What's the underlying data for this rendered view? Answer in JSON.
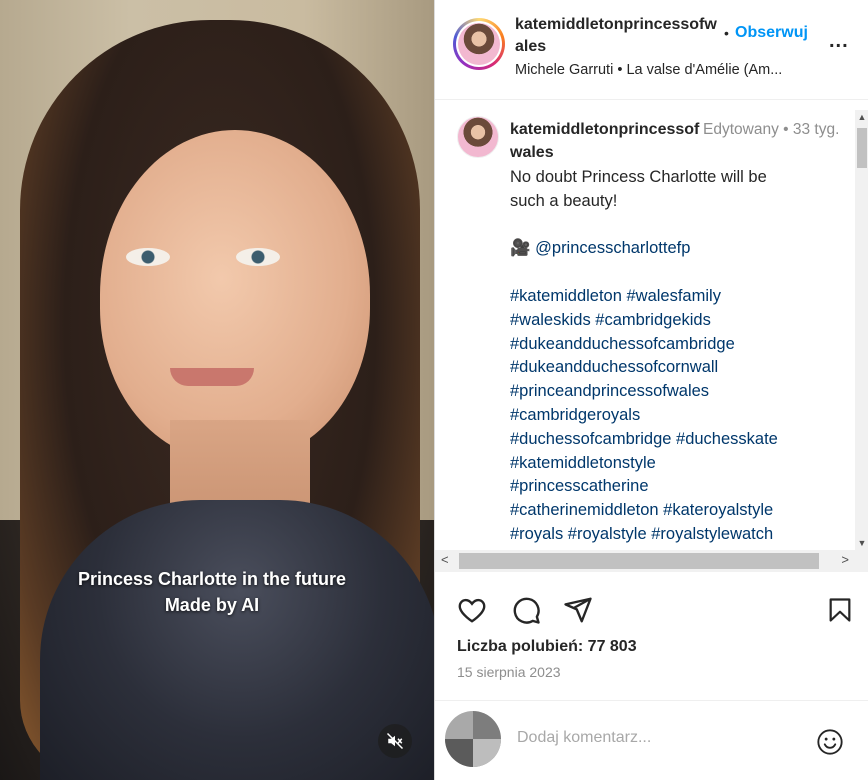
{
  "media": {
    "caption_line1": "Princess Charlotte in the future",
    "caption_line2": "Made by AI",
    "mute_icon": "speaker-muted-icon"
  },
  "header": {
    "username": "katemiddletonprincessofwales",
    "dot": "•",
    "follow_label": "Obserwuj",
    "more_label": "...",
    "music": "Michele Garruti • La valse d'Amélie (Am..."
  },
  "post": {
    "username": "katemiddletonprincessofwales",
    "meta": "Edytowany • 33 tyg.",
    "caption_lines": [
      "No doubt Princess Charlotte will be",
      "such a beauty!"
    ],
    "mention_emoji": "🎥",
    "mention": "@princesscharlottefp",
    "hashtag_lines": [
      "#katemiddleton #walesfamily",
      "#waleskids #cambridgekids",
      "#dukeandduchessofcambridge",
      "#dukeandduchessofcornwall",
      "#princeandprincessofwales",
      "#cambridgeroyals",
      "#duchessofcambridge #duchesskate",
      "#katemiddletonstyle",
      "#princesscatherine",
      "#catherinemiddleton #kateroyalstyle",
      "#royals #royalstyle #royalstylewatch"
    ]
  },
  "scroll": {
    "up": "▲",
    "down": "▼",
    "left": "<",
    "right": ">"
  },
  "actions": {
    "like_icon": "heart-icon",
    "comment_icon": "comment-icon",
    "share_icon": "send-icon",
    "save_icon": "bookmark-icon"
  },
  "likes_text": "Liczba polubień: 77 803",
  "date_text": "15 sierpnia 2023",
  "add_comment": {
    "placeholder": "Dodaj komentarz...",
    "emoji_icon": "smiley-icon"
  },
  "colors": {
    "link_blue": "#0095f6",
    "hashtag": "#00376b",
    "muted": "#8e8e8e"
  }
}
